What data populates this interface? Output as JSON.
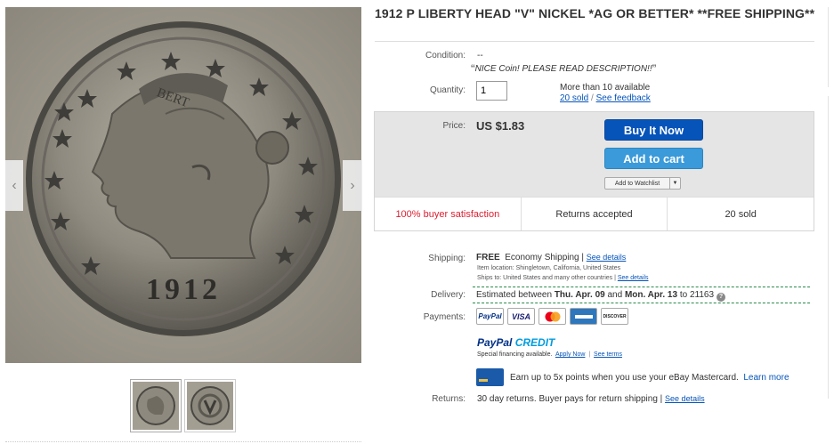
{
  "listing": {
    "title": "1912 P LIBERTY HEAD \"V\" NICKEL *AG OR BETTER* **FREE SHIPPING**"
  },
  "image": {
    "coin_year": "1912",
    "coin_ribbon": "BERT"
  },
  "condition": {
    "label": "Condition:",
    "value": "--",
    "note": "NICE Coin! PLEASE READ DESCRIPTION!!",
    "open_quote": "“",
    "close_quote": "”"
  },
  "quantity": {
    "label": "Quantity:",
    "value": "1",
    "available": "More than 10 available",
    "sold_link": "20 sold",
    "sep": "/",
    "feedback_link": "See feedback"
  },
  "price": {
    "label": "Price:",
    "value": "US $1.83"
  },
  "buttons": {
    "buy_now": "Buy It Now",
    "add_to_cart": "Add to cart",
    "watchlist": "Add to Watchlist",
    "watchlist_arrow": "▼"
  },
  "stats": {
    "satisfaction": "100% buyer satisfaction",
    "returns": "Returns accepted",
    "sold": "20 sold"
  },
  "shipping": {
    "label": "Shipping:",
    "free": "FREE",
    "method": "Economy Shipping |",
    "details_link": "See details",
    "item_location": "Item location:  Shingletown, California, United States",
    "ships_to": "Ships to:  United States and many other countries |",
    "ships_details_link": "See details"
  },
  "delivery": {
    "label": "Delivery:",
    "text_prefix": "Estimated between ",
    "date_start": "Thu. Apr. 09",
    "and": " and ",
    "date_end": "Mon. Apr. 13",
    "to": " to 21163",
    "help": "?"
  },
  "payments": {
    "label": "Payments:",
    "methods": [
      "PayPal",
      "VISA",
      "MC",
      "AMEX",
      "DISCOVER"
    ]
  },
  "paypal_credit": {
    "brand_1": "PayPal",
    "brand_2": "CREDIT",
    "sub": "Special financing available.",
    "apply_link": "Apply Now",
    "sep": "|",
    "terms_link": "See terms"
  },
  "mastercard": {
    "text": "Earn up to 5x points when you use your eBay Mastercard.",
    "link": "Learn more"
  },
  "returns": {
    "label": "Returns:",
    "value": "30 day returns. Buyer pays for return shipping |",
    "details_link": "See details"
  },
  "colors": {
    "ebay_blue": "#0654ba",
    "cart_blue": "#3b9ad9",
    "satisfaction_red": "#dd1e31",
    "delivery_green": "#2a8a4a"
  },
  "icons": {
    "prev": "chevron-left-icon",
    "next": "chevron-right-icon",
    "help": "help-circle-icon"
  },
  "nav": {
    "prev_glyph": "‹",
    "next_glyph": "›"
  }
}
